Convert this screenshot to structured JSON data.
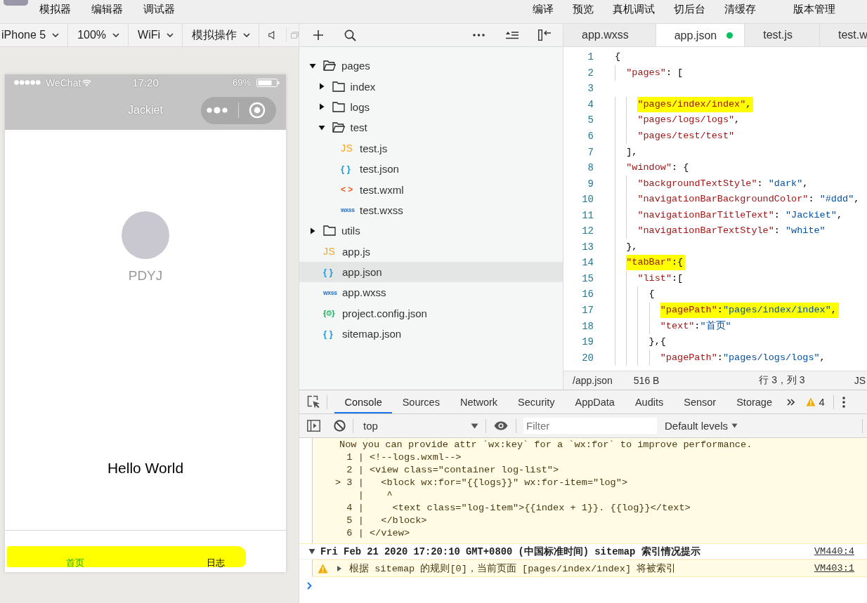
{
  "menubar": {
    "left_items": [
      "模拟器",
      "编辑器",
      "调试器"
    ],
    "right_items": [
      "编译",
      "预览",
      "真机调试",
      "切后台",
      "清缓存",
      "版本管理"
    ]
  },
  "simulator_toolbar": {
    "dropdowns": [
      "iPhone 5",
      "100%",
      "WiFi",
      "模拟操作"
    ]
  },
  "phone": {
    "status_bar": {
      "carrier": "WeChat",
      "time": "17:20",
      "battery": "69%"
    },
    "nav_bar": {
      "title": "Jackiet"
    },
    "page": {
      "nickname": "PDYJ",
      "greeting": "Hello World"
    },
    "tab_bar": {
      "highlighted": true,
      "tabs": [
        {
          "label": "首页",
          "selected": true
        },
        {
          "label": "日志",
          "selected": false
        }
      ]
    }
  },
  "file_tree": [
    {
      "kind": "folder",
      "name": "pages",
      "expanded": true,
      "selected": false,
      "children": [
        {
          "kind": "folder",
          "name": "index",
          "expanded": false,
          "selected": false
        },
        {
          "kind": "folder",
          "name": "logs",
          "expanded": false,
          "selected": false
        },
        {
          "kind": "folder",
          "name": "test",
          "expanded": true,
          "selected": false,
          "children": [
            {
              "kind": "js",
              "icon_text": "JS",
              "name": "test.js",
              "selected": false
            },
            {
              "kind": "json",
              "icon_text": "{ }",
              "name": "test.json",
              "selected": false
            },
            {
              "kind": "wxml",
              "icon_text": "< >",
              "name": "test.wxml",
              "selected": false
            },
            {
              "kind": "wxss",
              "icon_text": "wxss",
              "name": "test.wxss",
              "selected": false
            }
          ]
        }
      ]
    },
    {
      "kind": "folder",
      "name": "utils",
      "expanded": false,
      "selected": false
    },
    {
      "kind": "js",
      "icon_text": "JS",
      "name": "app.js",
      "selected": false
    },
    {
      "kind": "json",
      "icon_text": "{ }",
      "name": "app.json",
      "selected": true
    },
    {
      "kind": "wxss",
      "icon_text": "wxss",
      "name": "app.wxss",
      "selected": false
    },
    {
      "kind": "config",
      "icon_text": "{⚙}",
      "name": "project.config.json",
      "selected": false
    },
    {
      "kind": "json",
      "icon_text": "{ }",
      "name": "sitemap.json",
      "selected": false
    }
  ],
  "editor_tabs": [
    {
      "label": "app.wxss",
      "selected": false,
      "modified": false
    },
    {
      "label": "app.json",
      "selected": true,
      "modified": true
    },
    {
      "label": "test.js",
      "selected": false,
      "modified": false
    },
    {
      "label": "test.w",
      "selected": false,
      "modified": false
    }
  ],
  "editor": {
    "lines": [
      {
        "number": "1",
        "highlighted": false,
        "tokens": [
          {
            "kind": "punct",
            "text": "{"
          }
        ]
      },
      {
        "number": "2",
        "highlighted": false,
        "tokens": [
          {
            "kind": "key",
            "text": "  \"pages\""
          },
          {
            "kind": "punct",
            "text": ": ["
          }
        ]
      },
      {
        "number": "3"
      },
      {
        "number": "4",
        "highlighted": true,
        "tokens": [
          {
            "kind": "key",
            "text": "    \"pages/index/index\""
          },
          {
            "kind": "punct",
            "text": ","
          }
        ]
      },
      {
        "number": "5",
        "highlighted": false,
        "tokens": [
          {
            "kind": "key",
            "text": "    \"pages/logs/logs\""
          },
          {
            "kind": "punct",
            "text": ","
          }
        ]
      },
      {
        "number": "6",
        "highlighted": false,
        "tokens": [
          {
            "kind": "key",
            "text": "    \"pages/test/test\""
          }
        ]
      },
      {
        "number": "7",
        "highlighted": false,
        "tokens": [
          {
            "kind": "punct",
            "text": "  ],"
          }
        ]
      },
      {
        "number": "8",
        "highlighted": false,
        "tokens": [
          {
            "kind": "key",
            "text": "  \"window\""
          },
          {
            "kind": "punct",
            "text": ": {"
          }
        ]
      },
      {
        "number": "9",
        "highlighted": false,
        "tokens": [
          {
            "kind": "key",
            "text": "    \"backgroundTextStyle\""
          },
          {
            "kind": "punct",
            "text": ": "
          },
          {
            "kind": "value",
            "text": "\"dark\""
          },
          {
            "kind": "punct",
            "text": ","
          }
        ]
      },
      {
        "number": "10",
        "highlighted": false,
        "tokens": [
          {
            "kind": "key",
            "text": "    \"navigationBarBackgroundColor\""
          },
          {
            "kind": "punct",
            "text": ": "
          },
          {
            "kind": "value",
            "text": "\"#ddd\""
          },
          {
            "kind": "punct",
            "text": ","
          }
        ]
      },
      {
        "number": "11",
        "highlighted": false,
        "tokens": [
          {
            "kind": "key",
            "text": "    \"navigationBarTitleText\""
          },
          {
            "kind": "punct",
            "text": ": "
          },
          {
            "kind": "value",
            "text": "\"Jackiet\""
          },
          {
            "kind": "punct",
            "text": ","
          }
        ]
      },
      {
        "number": "12",
        "highlighted": false,
        "tokens": [
          {
            "kind": "key",
            "text": "    \"navigationBarTextStyle\""
          },
          {
            "kind": "punct",
            "text": ": "
          },
          {
            "kind": "value",
            "text": "\"white\""
          }
        ]
      },
      {
        "number": "13",
        "highlighted": false,
        "tokens": [
          {
            "kind": "punct",
            "text": "  },"
          }
        ]
      },
      {
        "number": "14",
        "highlighted": true,
        "tokens": [
          {
            "kind": "key",
            "text": "  \"tabBar\""
          },
          {
            "kind": "punct",
            "text": ":{"
          }
        ]
      },
      {
        "number": "15",
        "highlighted": false,
        "tokens": [
          {
            "kind": "key",
            "text": "    \"list\""
          },
          {
            "kind": "punct",
            "text": ":["
          }
        ]
      },
      {
        "number": "16",
        "highlighted": false,
        "tokens": [
          {
            "kind": "punct",
            "text": "      {"
          }
        ]
      },
      {
        "number": "17",
        "highlighted": true,
        "tokens": [
          {
            "kind": "key",
            "text": "        \"pagePath\""
          },
          {
            "kind": "punct",
            "text": ":"
          },
          {
            "kind": "value",
            "text": "\"pages/index/index\""
          },
          {
            "kind": "punct",
            "text": ","
          }
        ]
      },
      {
        "number": "18",
        "highlighted": false,
        "tokens": [
          {
            "kind": "key",
            "text": "        \"text\""
          },
          {
            "kind": "punct",
            "text": ":"
          },
          {
            "kind": "value",
            "text": "\"首页\""
          }
        ]
      },
      {
        "number": "19",
        "highlighted": false,
        "tokens": [
          {
            "kind": "punct",
            "text": "      },{"
          }
        ]
      },
      {
        "number": "20",
        "highlighted": false,
        "tokens": [
          {
            "kind": "key",
            "text": "        \"pagePath\""
          },
          {
            "kind": "punct",
            "text": ":"
          },
          {
            "kind": "value",
            "text": "\"pages/logs/logs\""
          },
          {
            "kind": "punct",
            "text": ","
          }
        ]
      }
    ],
    "status_bar": {
      "path": "/app.json",
      "size": "516 B",
      "cursor": "行 3，列 3",
      "language": "JS"
    }
  },
  "console": {
    "tabs": [
      {
        "label": "Console",
        "selected": true
      },
      {
        "label": "Sources",
        "selected": false
      },
      {
        "label": "Network",
        "selected": false
      },
      {
        "label": "Security",
        "selected": false
      },
      {
        "label": "AppData",
        "selected": false
      },
      {
        "label": "Audits",
        "selected": false
      },
      {
        "label": "Sensor",
        "selected": false
      },
      {
        "label": "Storage",
        "selected": false
      }
    ],
    "warning_count": "4",
    "context": "top",
    "filter_placeholder": "Filter",
    "levels": "Default levels",
    "messages": [
      {
        "kind": "frame",
        "text": "Now you can provide attr `wx:key` for a `wx:for` to improve performance.",
        "lines": [
          "  1 | <!--logs.wxml-->",
          "  2 | <view class=\"container log-list\">",
          "> 3 |   <block wx:for=\"{{logs}}\" wx:for-item=\"log\">",
          "    |    ^",
          "  4 |     <text class=\"log-item\">{{index + 1}}. {{log}}</text>",
          "  5 |   </block>",
          "  6 | </view>"
        ]
      },
      {
        "kind": "group",
        "expanded": true,
        "text": "Fri Feb 21 2020 17:20:10 GMT+0800 (中国标准时间) sitemap 索引情况提示",
        "source": "VM440:4"
      },
      {
        "kind": "warning",
        "expanded": false,
        "text": "根据 sitemap 的规则[0]，当前页面 [pages/index/index] 将被索引",
        "source": "VM403:1"
      }
    ]
  }
}
